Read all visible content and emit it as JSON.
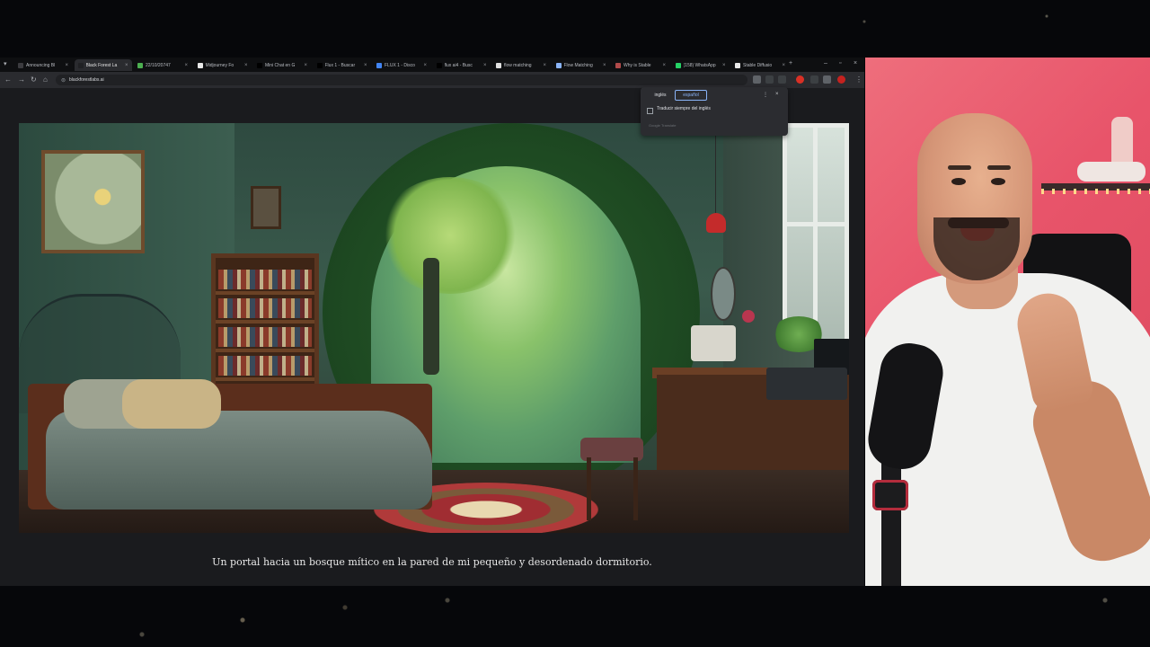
{
  "browser": {
    "tabs": [
      {
        "title": "Announcing Bl",
        "favicon_color": "#3b3b3f"
      },
      {
        "title": "Black Forest La",
        "favicon_color": "#202124",
        "active": true
      },
      {
        "title": "22/10/20747",
        "favicon_color": "#4caf50"
      },
      {
        "title": "Midjourney Fo",
        "favicon_color": "#e8e8e8"
      },
      {
        "title": "Mini Chat en G",
        "favicon_color": "#000000"
      },
      {
        "title": "Flux 1 - Buscar",
        "favicon_color": "#000000"
      },
      {
        "title": "FLUX 1 - Disco",
        "favicon_color": "#4285f4"
      },
      {
        "title": "flux ai4 - Busc",
        "favicon_color": "#000000"
      },
      {
        "title": "flow matching",
        "favicon_color": "#e0e0e0"
      },
      {
        "title": "Flow Matching",
        "favicon_color": "#8ab4f8"
      },
      {
        "title": "Why is Stable",
        "favicon_color": "#b04a4a"
      },
      {
        "title": "(158) WhatsApp",
        "favicon_color": "#25d366"
      },
      {
        "title": "Stable Diffusio",
        "favicon_color": "#e8e8e8"
      }
    ],
    "tab_close_glyph": "×",
    "new_tab_glyph": "+",
    "url": "blackforestlabs.ai",
    "nav": {
      "back": "←",
      "forward": "→",
      "reload": "↻",
      "home": "⌂"
    }
  },
  "translate_popup": {
    "source_lang": "inglés",
    "target_lang": "español",
    "checkbox_label": "Traducir siempre del inglés",
    "footer": "Google Translate",
    "menu_glyph": "⋮",
    "close_glyph": "×"
  },
  "page": {
    "caption": "Un portal hacia un bosque mítico en la pared de mi pequeño y desordenado dormitorio."
  },
  "colors": {
    "accent": "#8ab4f8",
    "webcam_bg": "#e8546a"
  }
}
